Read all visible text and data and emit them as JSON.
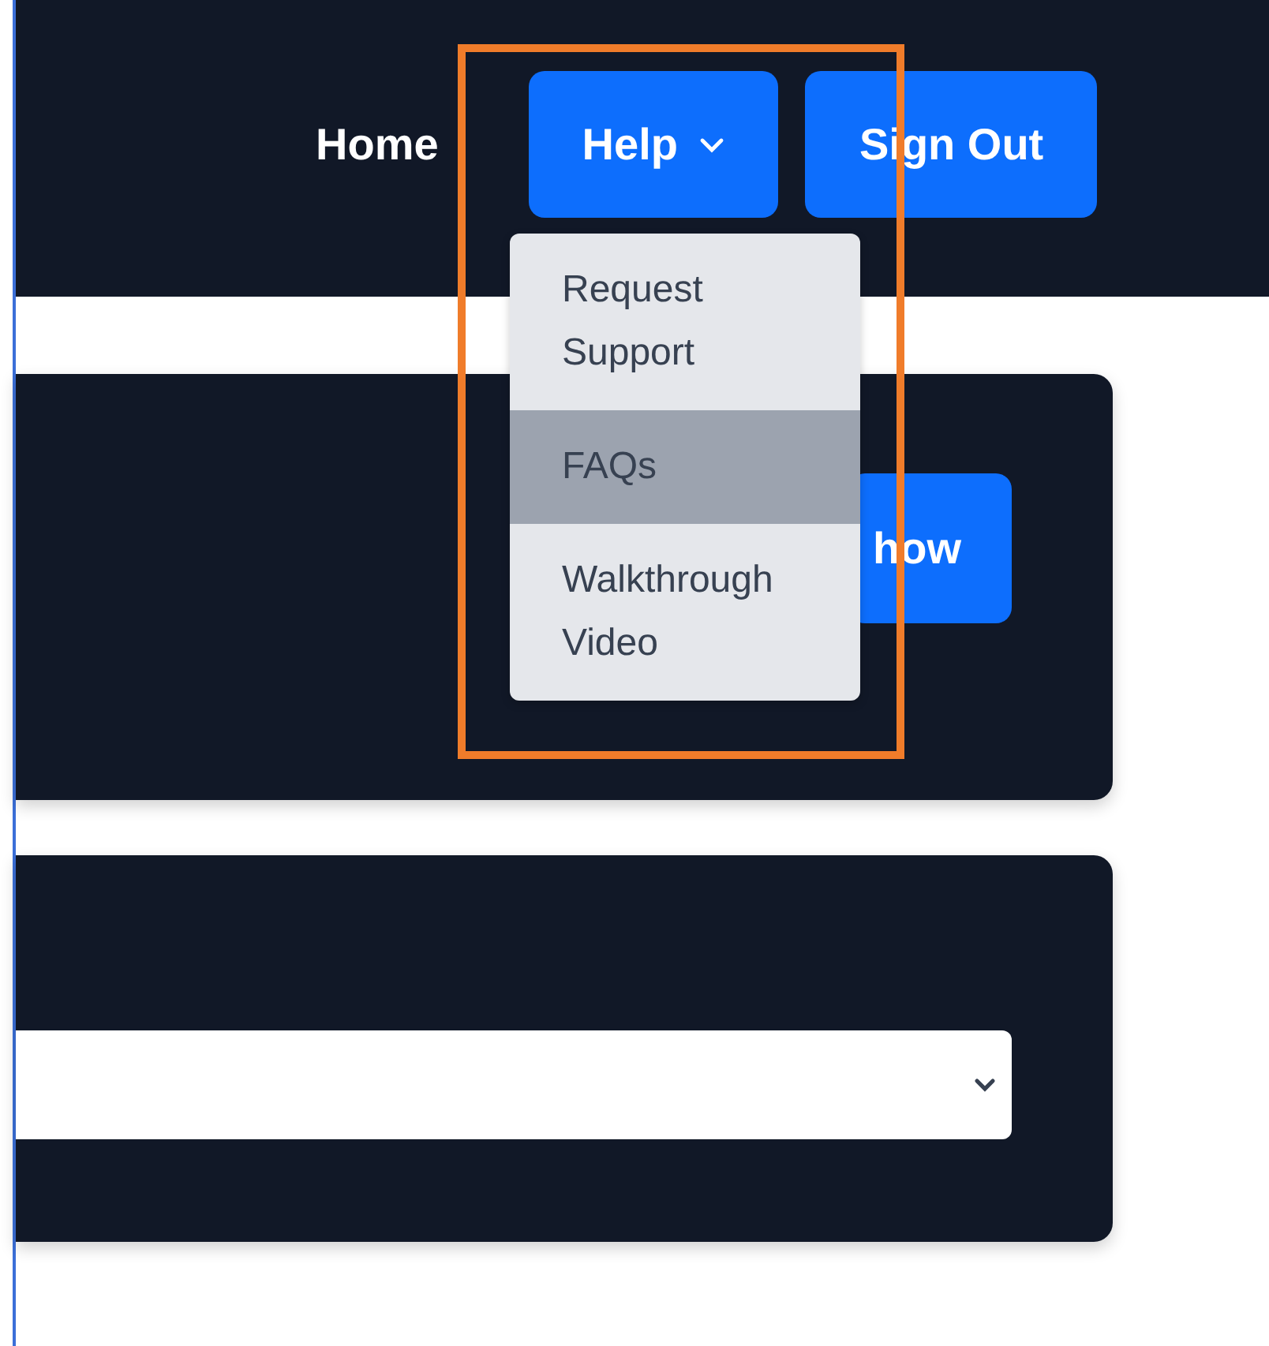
{
  "navbar": {
    "links": [
      {
        "label": "Home",
        "kind": "link"
      },
      {
        "label": "Help",
        "kind": "dropdown",
        "expanded": true
      },
      {
        "label": "Sign Out",
        "kind": "button"
      }
    ]
  },
  "help_menu": {
    "items": [
      {
        "label": "Request Support",
        "selected": false
      },
      {
        "label": "FAQs",
        "selected": true
      },
      {
        "label": "Walkthrough Video",
        "selected": false
      }
    ]
  },
  "cards": [
    {
      "kind": "button",
      "button": "how"
    },
    {
      "kind": "select"
    }
  ]
}
